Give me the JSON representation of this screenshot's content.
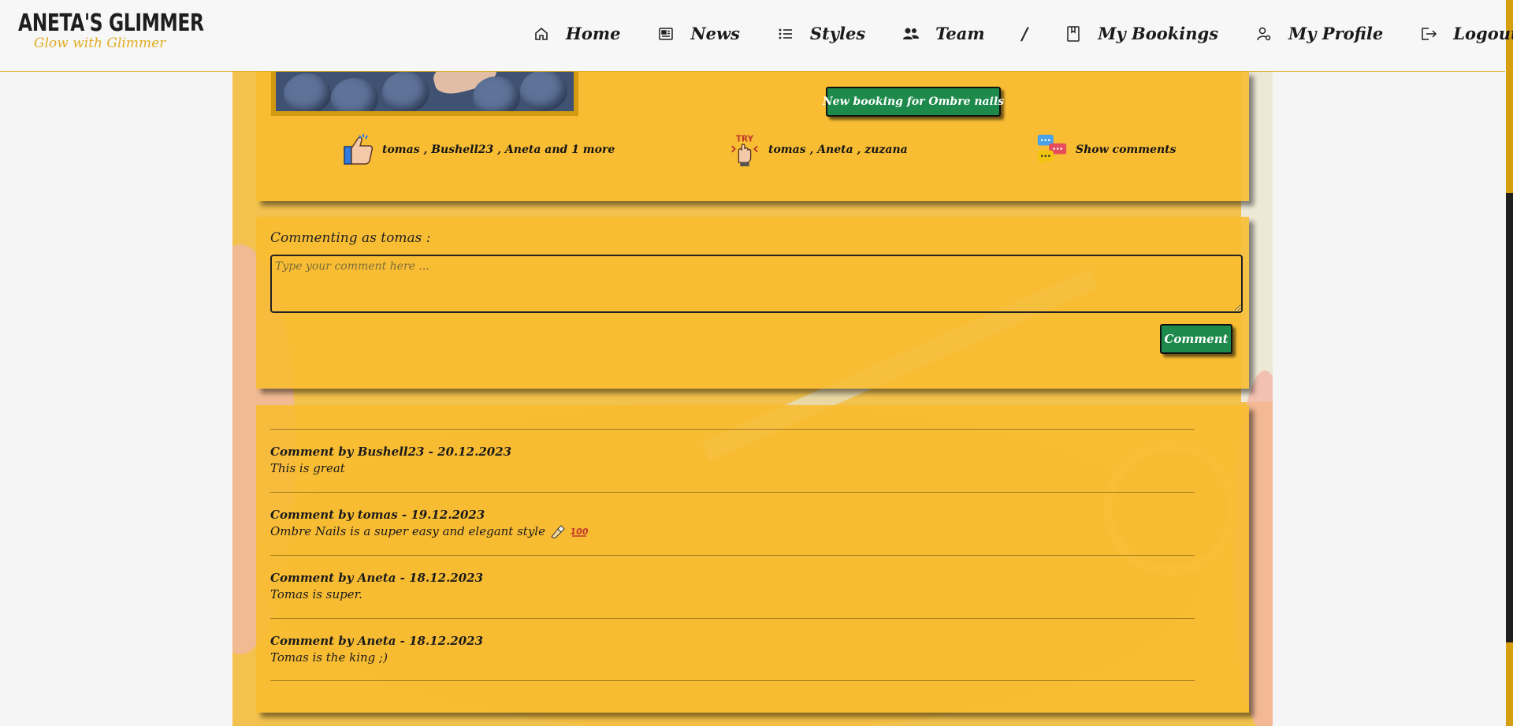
{
  "brand": {
    "name": "ANETA'S GLIMMER",
    "tagline": "Glow with Glimmer"
  },
  "nav": {
    "items": [
      {
        "label": "Home",
        "icon": "home-icon"
      },
      {
        "label": "News",
        "icon": "newspaper-icon"
      },
      {
        "label": "Styles",
        "icon": "list-icon"
      },
      {
        "label": "Team",
        "icon": "team-icon"
      }
    ],
    "separator": "/",
    "items_right": [
      {
        "label": "My Bookings",
        "icon": "bookmark-book-icon"
      },
      {
        "label": "My Profile",
        "icon": "user-gear-icon"
      },
      {
        "label": "Logout",
        "icon": "logout-icon"
      }
    ]
  },
  "post": {
    "new_booking_label": "New booking for Ombre nails",
    "likes_text": "tomas , Bushell23 , Aneta and 1 more",
    "tries_text": "tomas , Aneta , zuzana",
    "show_comments_label": "Show comments",
    "try_badge": "TRY"
  },
  "comment_form": {
    "label": "Commenting as tomas :",
    "placeholder": "Type your comment here ...",
    "submit_label": "Comment"
  },
  "comments": [
    {
      "header": "Comment by Bushell23 - 20.12.2023",
      "text": "This is great"
    },
    {
      "header": "Comment by tomas - 19.12.2023",
      "text": "Ombre Nails is a super easy and elegant style"
    },
    {
      "header": "Comment by Aneta - 18.12.2023",
      "text": "Tomas is super."
    },
    {
      "header": "Comment by Aneta - 18.12.2023",
      "text": "Tomas is the king ;)"
    }
  ],
  "colors": {
    "accent": "#e0ad20",
    "card": "#f8bc30",
    "button_green": "#1d8a4b",
    "scrollbar": "#d79e12"
  }
}
